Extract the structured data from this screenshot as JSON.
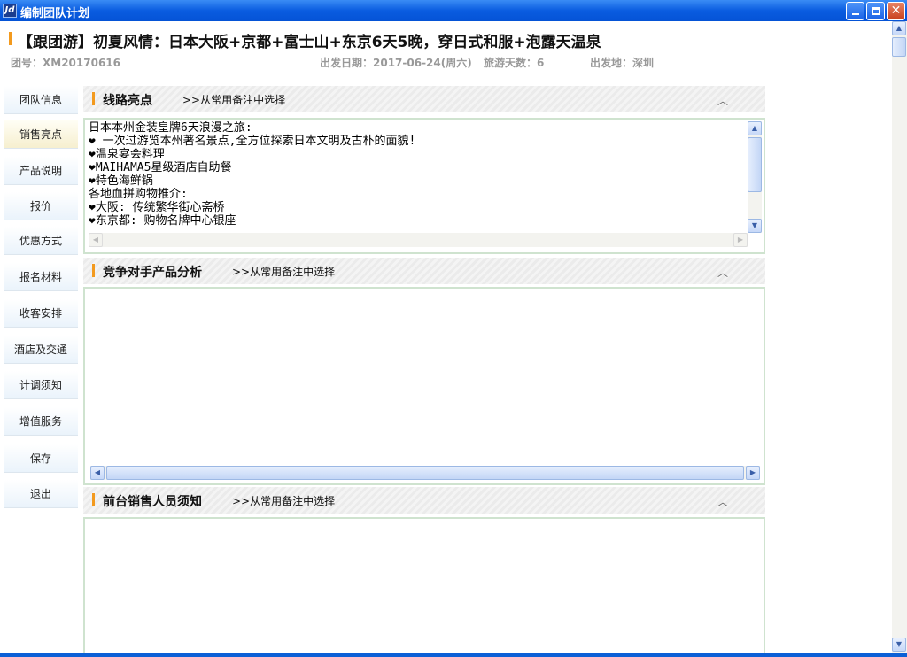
{
  "window": {
    "title": "编制团队计划",
    "app_icon": "Jd"
  },
  "header": {
    "title": "【跟团游】初夏风情：日本大阪+京都+富士山+东京6天5晚，穿日式和服+泡露天温泉",
    "group_no": "团号：XM20170616",
    "depart_date": "出发日期：2017-06-24(周六)",
    "days": "旅游天数：6",
    "depart_from": "出发地：深圳"
  },
  "sidebar": {
    "items": [
      {
        "label": "团队信息"
      },
      {
        "label": "销售亮点"
      },
      {
        "label": "产品说明"
      },
      {
        "label": "报价"
      },
      {
        "label": "优惠方式"
      },
      {
        "label": "报名材料"
      },
      {
        "label": "收客安排"
      },
      {
        "label": "酒店及交通"
      },
      {
        "label": "计调须知"
      },
      {
        "label": "增值服务"
      },
      {
        "label": "保存"
      },
      {
        "label": "退出"
      }
    ]
  },
  "sections": [
    {
      "label": "线路亮点",
      "pick": ">>从常用备注中选择",
      "collapse": "︿",
      "content": "日本本州金装皇牌6天浪漫之旅:\n❤ 一次过游览本州著名景点,全方位探索日本文明及古朴的面貌!\n❤温泉宴会料理\n❤MAIHAMA5星级酒店自助餐\n❤特色海鲜锅\n各地血拼购物推介:\n❤大阪: 传统繁华街心斋桥\n❤东京都: 购物名牌中心银座"
    },
    {
      "label": "竞争对手产品分析",
      "pick": ">>从常用备注中选择",
      "collapse": "︿",
      "content": ""
    },
    {
      "label": "前台销售人员须知",
      "pick": ">>从常用备注中选择",
      "collapse": "︿",
      "content": ""
    }
  ],
  "colors": {
    "accent": "#f39a1e",
    "titlebar": "#0a5ce0",
    "border": "#cfe3cf"
  }
}
